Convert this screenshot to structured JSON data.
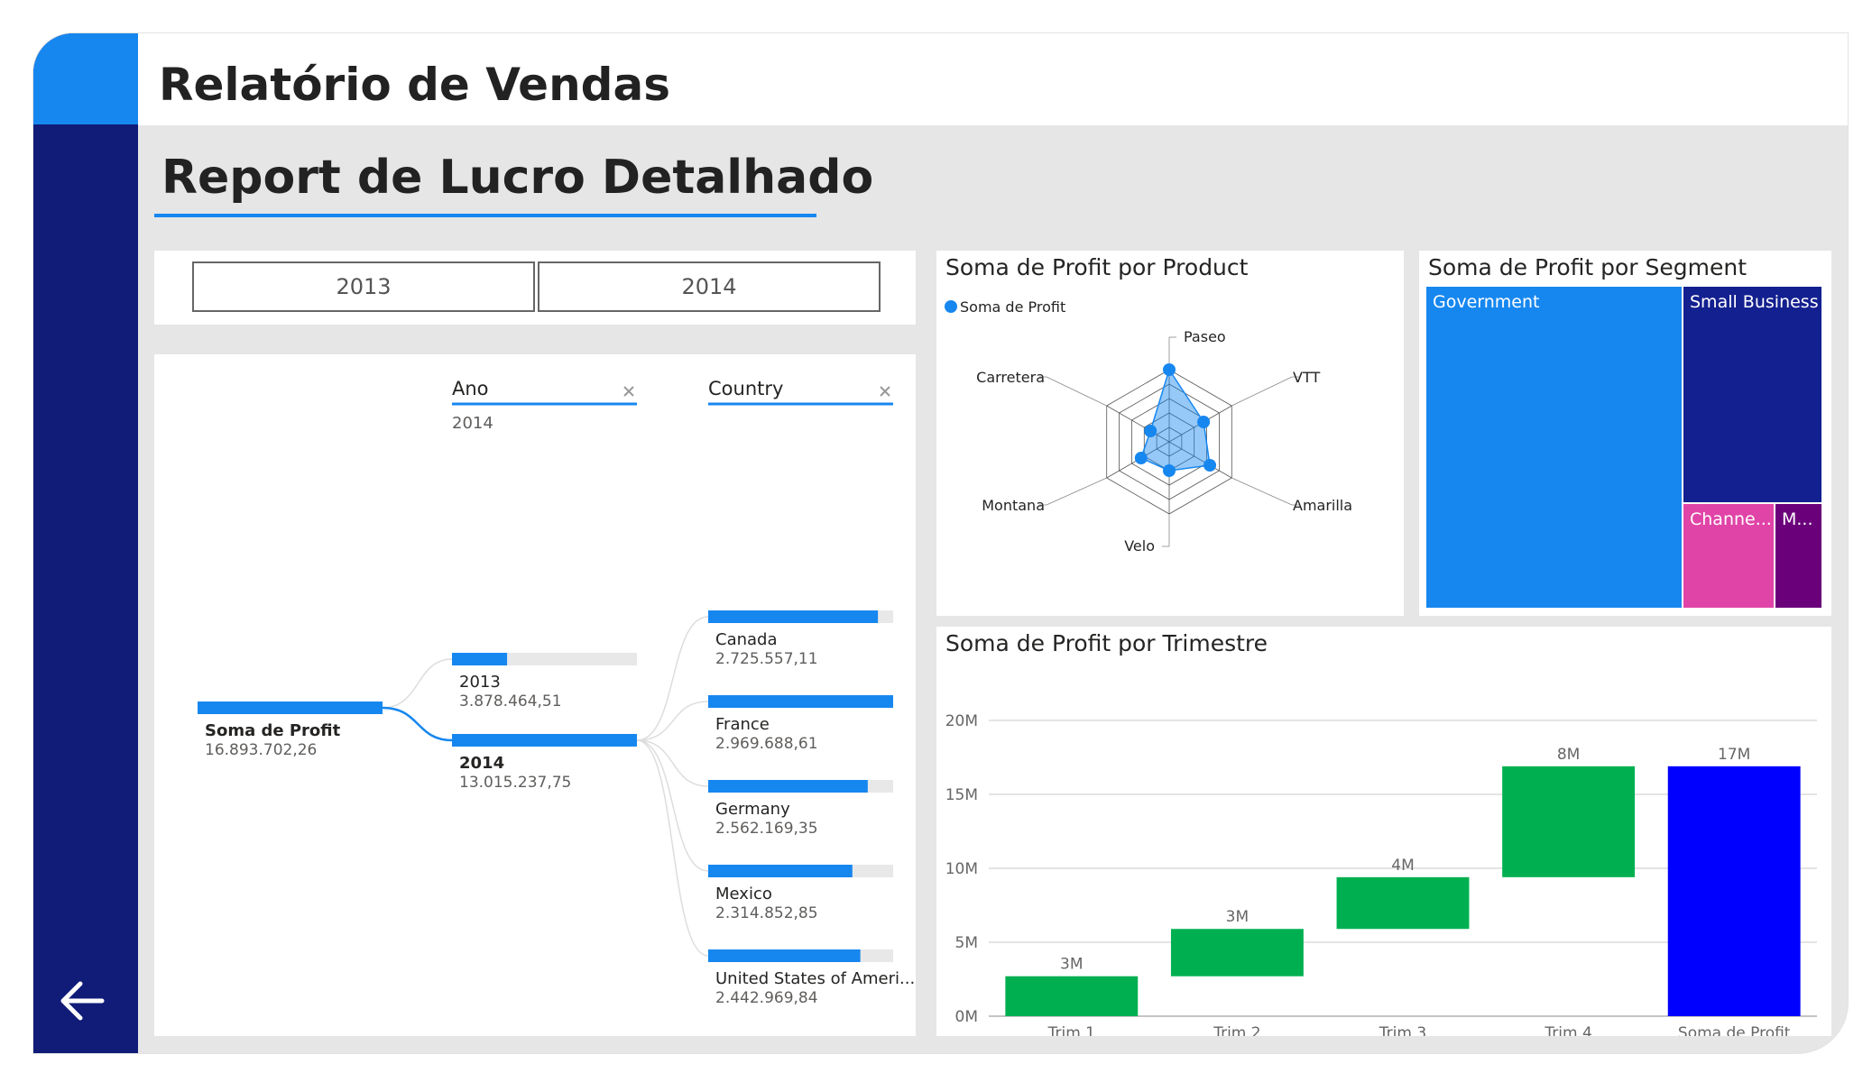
{
  "header": {
    "title": "Relatório de Vendas"
  },
  "page": {
    "title": "Report de Lucro Detalhado"
  },
  "year_slicer": {
    "options": [
      "2013",
      "2014"
    ]
  },
  "decomposition_tree": {
    "levels": [
      {
        "name": "Ano",
        "filter": "2014"
      },
      {
        "name": "Country",
        "filter": ""
      }
    ],
    "root": {
      "label": "Soma de Profit",
      "value": "16.893.702,26"
    },
    "years": [
      {
        "label": "2013",
        "value": "3.878.464,51",
        "amount": 3878464.51,
        "selected": false
      },
      {
        "label": "2014",
        "value": "13.015.237,75",
        "amount": 13015237.75,
        "selected": true
      }
    ],
    "countries": [
      {
        "label": "Canada",
        "value": "2.725.557,11",
        "amount": 2725557.11
      },
      {
        "label": "France",
        "value": "2.969.688,61",
        "amount": 2969688.61
      },
      {
        "label": "Germany",
        "value": "2.562.169,35",
        "amount": 2562169.35
      },
      {
        "label": "Mexico",
        "value": "2.314.852,85",
        "amount": 2314852.85
      },
      {
        "label": "United States of Ameri...",
        "value": "2.442.969,84",
        "amount": 2442969.84
      }
    ]
  },
  "radar": {
    "title": "Soma de Profit por Product",
    "legend": "Soma de Profit",
    "color": "#1787f0",
    "axes": [
      "Paseo",
      "VTT",
      "Amarilla",
      "Velo",
      "Montana",
      "Carretera"
    ],
    "levels": [
      1.0,
      0.55,
      0.65,
      0.4,
      0.45,
      0.3
    ]
  },
  "treemap": {
    "title": "Soma de Profit por Segment",
    "segments": [
      {
        "label": "Government",
        "color": "#1787f0"
      },
      {
        "label": "Small Business",
        "color": "#13208f"
      },
      {
        "label": "Channe...",
        "color": "#e044a7"
      },
      {
        "label": "M...",
        "color": "#6b007b"
      }
    ]
  },
  "chart_data": {
    "type": "waterfall",
    "title": "Soma de Profit por Trimestre",
    "categories": [
      "Trim 1",
      "Trim 2",
      "Trim 3",
      "Trim 4",
      "Soma de Profit"
    ],
    "values": [
      2.7,
      3.2,
      3.5,
      7.5,
      16.9
    ],
    "data_labels": [
      "3M",
      "3M",
      "4M",
      "8M",
      "17M"
    ],
    "y_ticks": [
      "0M",
      "5M",
      "10M",
      "15M",
      "20M"
    ],
    "ylim": [
      0,
      20
    ],
    "unit": "M",
    "increase_color": "#00b050",
    "total_color": "#0000ff",
    "grid": true
  }
}
